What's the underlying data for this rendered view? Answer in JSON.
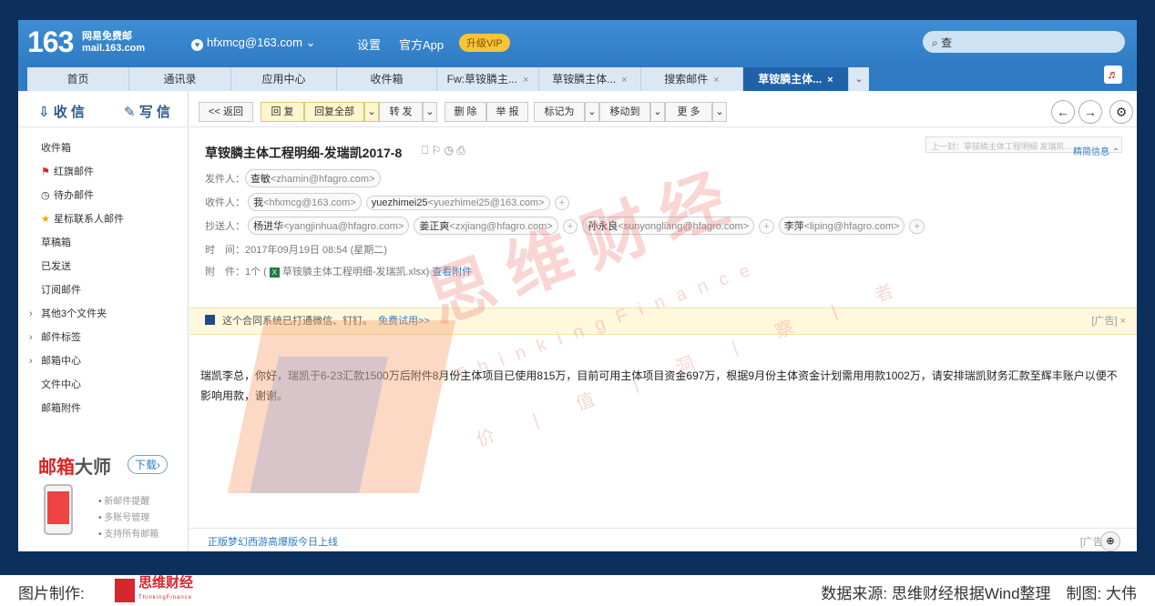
{
  "header": {
    "logo": "163",
    "logo_sub1": "网易免费邮",
    "logo_sub2": "mail.163.com",
    "account": "hfxmcg@163.com",
    "account_caret": "⌄",
    "account_icon": "♥",
    "nav": [
      "设置",
      "官方App"
    ],
    "vip": "升级VIP",
    "search_icon": "search-icon",
    "search_text": "查"
  },
  "tabs": [
    {
      "label": "首页",
      "close": ""
    },
    {
      "label": "通讯录",
      "close": ""
    },
    {
      "label": "应用中心",
      "close": ""
    },
    {
      "label": "收件箱",
      "close": ""
    },
    {
      "label": "Fw:草铵膦主...",
      "close": "×"
    },
    {
      "label": "草铵膦主体...",
      "close": "×"
    },
    {
      "label": "搜索邮件",
      "close": "×"
    },
    {
      "label": "草铵膦主体...",
      "close": "×"
    }
  ],
  "tab_more": "⌄",
  "music_icon": "♬",
  "sidebar": {
    "receive": "收 信",
    "write": "写 信",
    "items": [
      {
        "label": "收件箱",
        "icon": "",
        "arrow": ""
      },
      {
        "label": "红旗邮件",
        "icon": "⚑",
        "arrow": ""
      },
      {
        "label": "待办邮件",
        "icon": "◷",
        "arrow": ""
      },
      {
        "label": "星标联系人邮件",
        "icon": "★",
        "arrow": ""
      },
      {
        "label": "草稿箱",
        "icon": "",
        "arrow": ""
      },
      {
        "label": "已发送",
        "icon": "",
        "arrow": ""
      },
      {
        "label": "订阅邮件",
        "icon": "",
        "arrow": ""
      },
      {
        "label": "其他3个文件夹",
        "icon": "",
        "arrow": "›"
      },
      {
        "label": "邮件标签",
        "icon": "",
        "arrow": "›"
      },
      {
        "label": "邮箱中心",
        "icon": "",
        "arrow": "›"
      },
      {
        "label": "文件中心",
        "icon": "",
        "arrow": ""
      },
      {
        "label": "邮箱附件",
        "icon": "",
        "arrow": ""
      }
    ],
    "promo_title_a": "邮箱",
    "promo_title_b": "大师",
    "promo_download": "下载›",
    "promo_features": [
      "新邮件提醒",
      "多账号管理",
      "支持所有邮箱"
    ]
  },
  "toolbar": {
    "back": "<< 返回",
    "reply": "回 复",
    "reply_all": "回复全部",
    "caret": "⌄",
    "forward": "转 发",
    "delete": "删 除",
    "report": "举 报",
    "mark": "标记为",
    "move": "移动到",
    "more": "更 多",
    "prev": "←",
    "next": "→",
    "settings": "⚙"
  },
  "email": {
    "subject": "草铵膦主体工程明细-发瑞凯2017-8",
    "subject_icons": "⎕ ⚐ ◷ ⎙",
    "prev_next_hint": "上一封：草铵膦主体工程明细 发瑞凯...",
    "collapse": "精简信息 ⌃",
    "from_label": "发件人：",
    "from_name": "查敏",
    "from_addr": "<zhamin@hfagro.com>",
    "to_label": "收件人：",
    "to": [
      {
        "name": "我",
        "addr": "<hfxmcg@163.com>"
      },
      {
        "name": "yuezhimei25",
        "addr": "<yuezhimei25@163.com>"
      }
    ],
    "cc_label": "抄送人：",
    "cc": [
      {
        "name": "杨进华",
        "addr": "<yangjinhua@hfagro.com>"
      },
      {
        "name": "姜正爽",
        "addr": "<zxjiang@hfagro.com>"
      },
      {
        "name": "孙永良",
        "addr": "<sunyongliang@hfagro.com>"
      },
      {
        "name": "李萍",
        "addr": "<liping@hfagro.com>"
      }
    ],
    "plus": "+",
    "time_label": "时　间：",
    "time": "2017年09月19日 08:54 (星期二)",
    "attach_label": "附　件：",
    "attach_count": "1个 (",
    "attach_file": "草铵膦主体工程明细-发瑞凯.xlsx",
    ")": ")",
    "attach_close": ")",
    "view_attach": "查看附件",
    "notice": "这个合同系统已打通微信、钉钉。",
    "notice_link": "免费试用>>",
    "notice_ad": "[广告] ×",
    "body": "瑞凯李总，你好，瑞凯于6-23汇款1500万后附件8月份主体项目已使用815万，目前可用主体项目资金697万，根据9月份主体资金计划需用用款1002万，请安排瑞凯财务汇款至辉丰账户以便不影响用款，谢谢。",
    "footer_link": "正版梦幻西游高爆版今日上线",
    "footer_ad": "[广告]",
    "zoom_icon": "🔍"
  },
  "watermark": {
    "big": "思维财经",
    "en": "ThinkingFinance",
    "cn": "价 | 值 | 洞 | 察 | 者"
  },
  "caption": {
    "left": "图片制作:",
    "logo_name": "思维财经",
    "logo_en": "ThinkingFinance",
    "right": "数据来源: 思维财经根据Wind整理　制图: 大伟"
  }
}
